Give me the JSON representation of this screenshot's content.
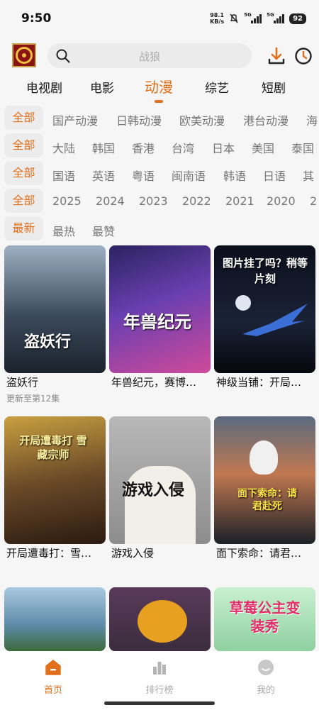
{
  "status_bar": {
    "time": "9:50",
    "net_speed_value": "98.1",
    "net_speed_unit": "KB/s",
    "sim1": "5G",
    "sim2": "5G",
    "battery": "92"
  },
  "search": {
    "placeholder": "战狼"
  },
  "main_tabs": [
    "电视剧",
    "电影",
    "动漫",
    "综艺",
    "短剧"
  ],
  "active_tab": "动漫",
  "filters": [
    {
      "selected": "全部",
      "options": [
        "国产动漫",
        "日韩动漫",
        "欧美动漫",
        "港台动漫",
        "海"
      ]
    },
    {
      "selected": "全部",
      "options": [
        "大陆",
        "韩国",
        "香港",
        "台湾",
        "日本",
        "美国",
        "泰国"
      ]
    },
    {
      "selected": "全部",
      "options": [
        "国语",
        "英语",
        "粤语",
        "闽南语",
        "韩语",
        "日语",
        "其"
      ]
    },
    {
      "selected": "全部",
      "options": [
        "2025",
        "2024",
        "2023",
        "2022",
        "2021",
        "2020",
        "2"
      ]
    },
    {
      "selected": "最新",
      "options": [
        "最热",
        "最赞"
      ]
    }
  ],
  "cards": [
    {
      "title": "盗妖行",
      "subtitle": "更新至第12集",
      "poster_text": "盗妖行",
      "bg": "#3b4a5c"
    },
    {
      "title": "年兽纪元，赛博…",
      "subtitle": "",
      "poster_text": "年兽纪元",
      "bg": "#4a3a8a"
    },
    {
      "title": "神级当铺：开局…",
      "subtitle": "",
      "poster_text": "图片挂了吗？稍等片刻",
      "bg": "#0e1525"
    },
    {
      "title": "开局遭毒打：雪…",
      "subtitle": "",
      "poster_text": "开局遭毒打 雪藏宗师",
      "bg": "#6b4a28"
    },
    {
      "title": "游戏入侵",
      "subtitle": "",
      "poster_text": "游戏入侵",
      "bg": "#8d8d8d"
    },
    {
      "title": "面下索命：请君…",
      "subtitle": "",
      "poster_text": "面下索命：请君赴死",
      "bg": "#2c3440"
    },
    {
      "title": "",
      "subtitle": "",
      "poster_text": "",
      "bg": "#5d8aa8"
    },
    {
      "title": "",
      "subtitle": "",
      "poster_text": "",
      "bg": "#3a2d3d"
    },
    {
      "title": "",
      "subtitle": "",
      "poster_text": "草莓公主变装秀",
      "bg": "#8fd0a0"
    }
  ],
  "bottom_nav": [
    {
      "label": "首页",
      "icon": "home-icon"
    },
    {
      "label": "排行榜",
      "icon": "ranking-icon"
    },
    {
      "label": "我的",
      "icon": "profile-icon"
    }
  ],
  "colors": {
    "accent": "#e0701c"
  }
}
